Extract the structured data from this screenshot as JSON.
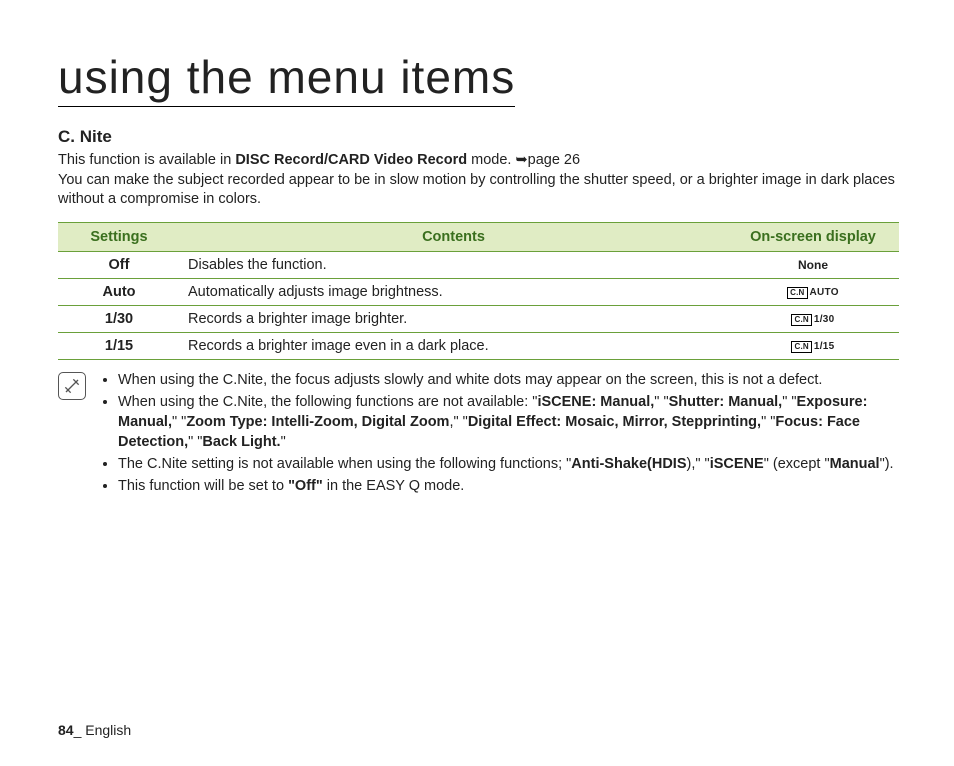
{
  "title": "using the menu items",
  "section": {
    "heading": "C. Nite",
    "intro_pre": "This function is available in ",
    "intro_bold": "DISC Record/CARD Video Record",
    "intro_post": " mode. ",
    "page_ref": "page 26",
    "intro_line2": "You can make the subject recorded appear to be in slow motion by controlling the shutter speed, or a brighter image in dark places without a compromise in colors."
  },
  "table": {
    "headers": {
      "settings": "Settings",
      "contents": "Contents",
      "display": "On-screen display"
    },
    "rows": [
      {
        "setting": "Off",
        "contents": "Disables the function.",
        "display_type": "none",
        "display_text": "None"
      },
      {
        "setting": "Auto",
        "contents": "Automatically adjusts image brightness.",
        "display_type": "cn",
        "display_text": "AUTO"
      },
      {
        "setting": "1/30",
        "contents": "Records a brighter image brighter.",
        "display_type": "cn",
        "display_text": "1/30"
      },
      {
        "setting": "1/15",
        "contents": "Records a brighter image even in a dark place.",
        "display_type": "cn",
        "display_text": "1/15"
      }
    ],
    "cn_box": "C.N"
  },
  "notes": {
    "n1": "When using the C.Nite, the focus adjusts slowly and white dots may appear on the screen, this is not a defect.",
    "n2": {
      "pre": "When using the C.Nite, the following functions are not available: \"",
      "b1": "iSCENE: Manual,",
      "m1": "\" \"",
      "b2": "Shutter: Manual,",
      "m2": "\" \"",
      "b3": "Exposure: Manual,",
      "m3": "\" \"",
      "b4": "Zoom Type: Intelli-Zoom, Digital Zoom",
      "m4": ",\" \"",
      "b5": "Digital Effect: Mosaic, Mirror, Stepprinting,",
      "m5": "\" \"",
      "b6": "Focus: Face Detection,",
      "m6": "\" \"",
      "b7": "Back Light.",
      "post": "\""
    },
    "n3": {
      "pre": "The C.Nite setting is not available when using the following functions; \"",
      "b1": "Anti-Shake(HDIS",
      "m1": "),\" \"",
      "b2": "iSCENE",
      "m2": "\" (except \"",
      "b3": "Manual",
      "post": "\")."
    },
    "n4": {
      "pre": "This function will be set to ",
      "b1": "\"Off\"",
      "post": " in the EASY Q mode."
    }
  },
  "footer": {
    "page": "84",
    "sep": "_ ",
    "lang": "English"
  }
}
